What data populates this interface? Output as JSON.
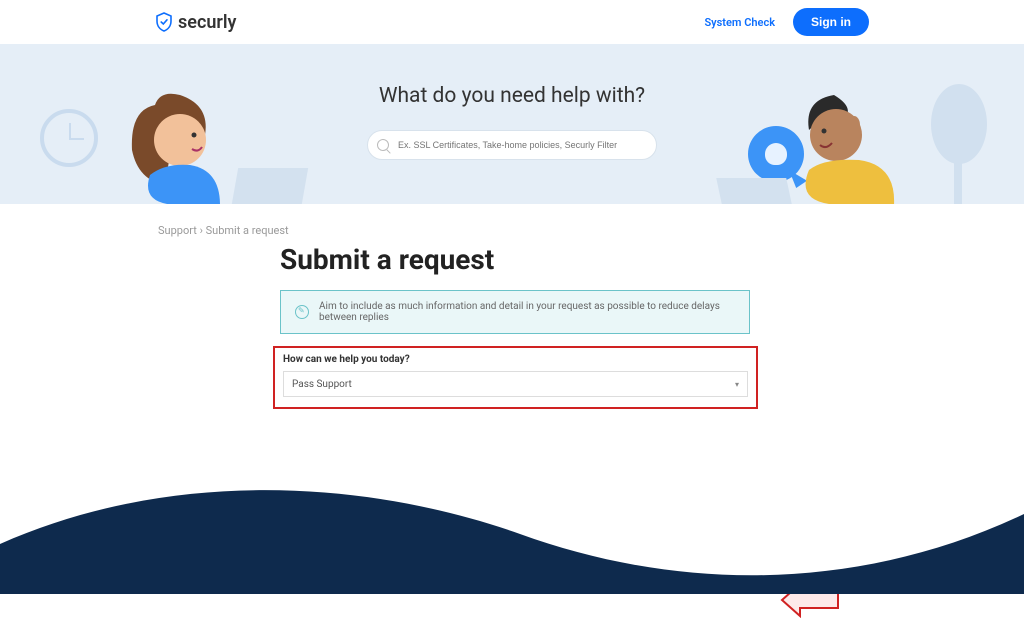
{
  "header": {
    "brand": "securly",
    "system_check": "System Check",
    "sign_in": "Sign in"
  },
  "hero": {
    "title": "What do you need help with?",
    "search_placeholder": "Ex. SSL Certificates, Take-home policies, Securly Filter"
  },
  "breadcrumb": {
    "root": "Support",
    "separator": "›",
    "current": "Submit a request"
  },
  "page": {
    "title": "Submit a request",
    "info_banner": "Aim to include as much information and detail in your request as possible to reduce delays between replies"
  },
  "form": {
    "question_label": "How can we help you today?",
    "selected_option": "Pass Support"
  },
  "colors": {
    "accent": "#0d6efd",
    "banner_border": "#6bc3c9",
    "highlight": "#d02222",
    "wave": "#0e2a4d"
  }
}
